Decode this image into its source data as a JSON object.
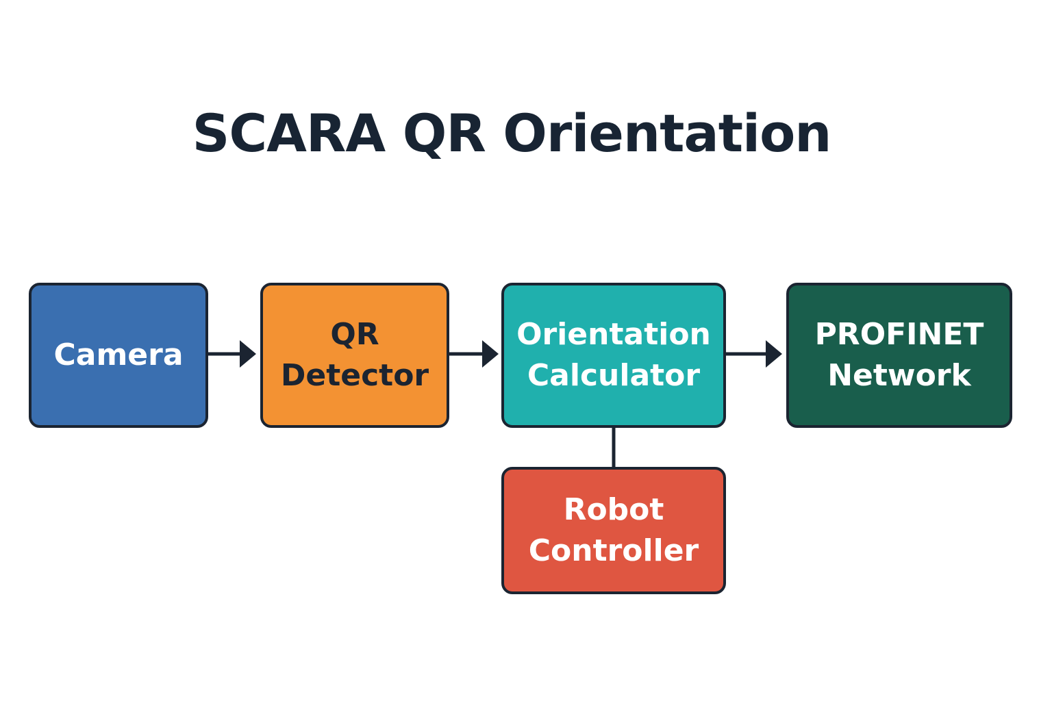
{
  "title": "SCARA QR Orientation",
  "colors": {
    "title_text": "#182433",
    "border": "#1b2431",
    "connector": "#1b2431",
    "camera_fill": "#3a6fb0",
    "qr_detector_fill": "#f39233",
    "orientation_fill": "#20b0ad",
    "profinet_fill": "#195e4c",
    "robot_fill": "#df5641",
    "light_text": "#ffffff",
    "dark_text": "#1b2431"
  },
  "nodes": {
    "camera": {
      "lines": [
        "Camera"
      ]
    },
    "qr_detector": {
      "lines": [
        "QR",
        "Detector"
      ]
    },
    "orientation_calculator": {
      "lines": [
        "Orientation",
        "Calculator"
      ]
    },
    "profinet_network": {
      "lines": [
        "PROFINET",
        "Network"
      ]
    },
    "robot_controller": {
      "lines": [
        "Robot",
        "Controller"
      ]
    }
  },
  "edges": [
    {
      "from": "camera",
      "to": "qr_detector",
      "arrow": true
    },
    {
      "from": "qr_detector",
      "to": "orientation_calculator",
      "arrow": true
    },
    {
      "from": "orientation_calculator",
      "to": "profinet_network",
      "arrow": true
    },
    {
      "from": "orientation_calculator",
      "to": "robot_controller",
      "arrow": false
    }
  ]
}
